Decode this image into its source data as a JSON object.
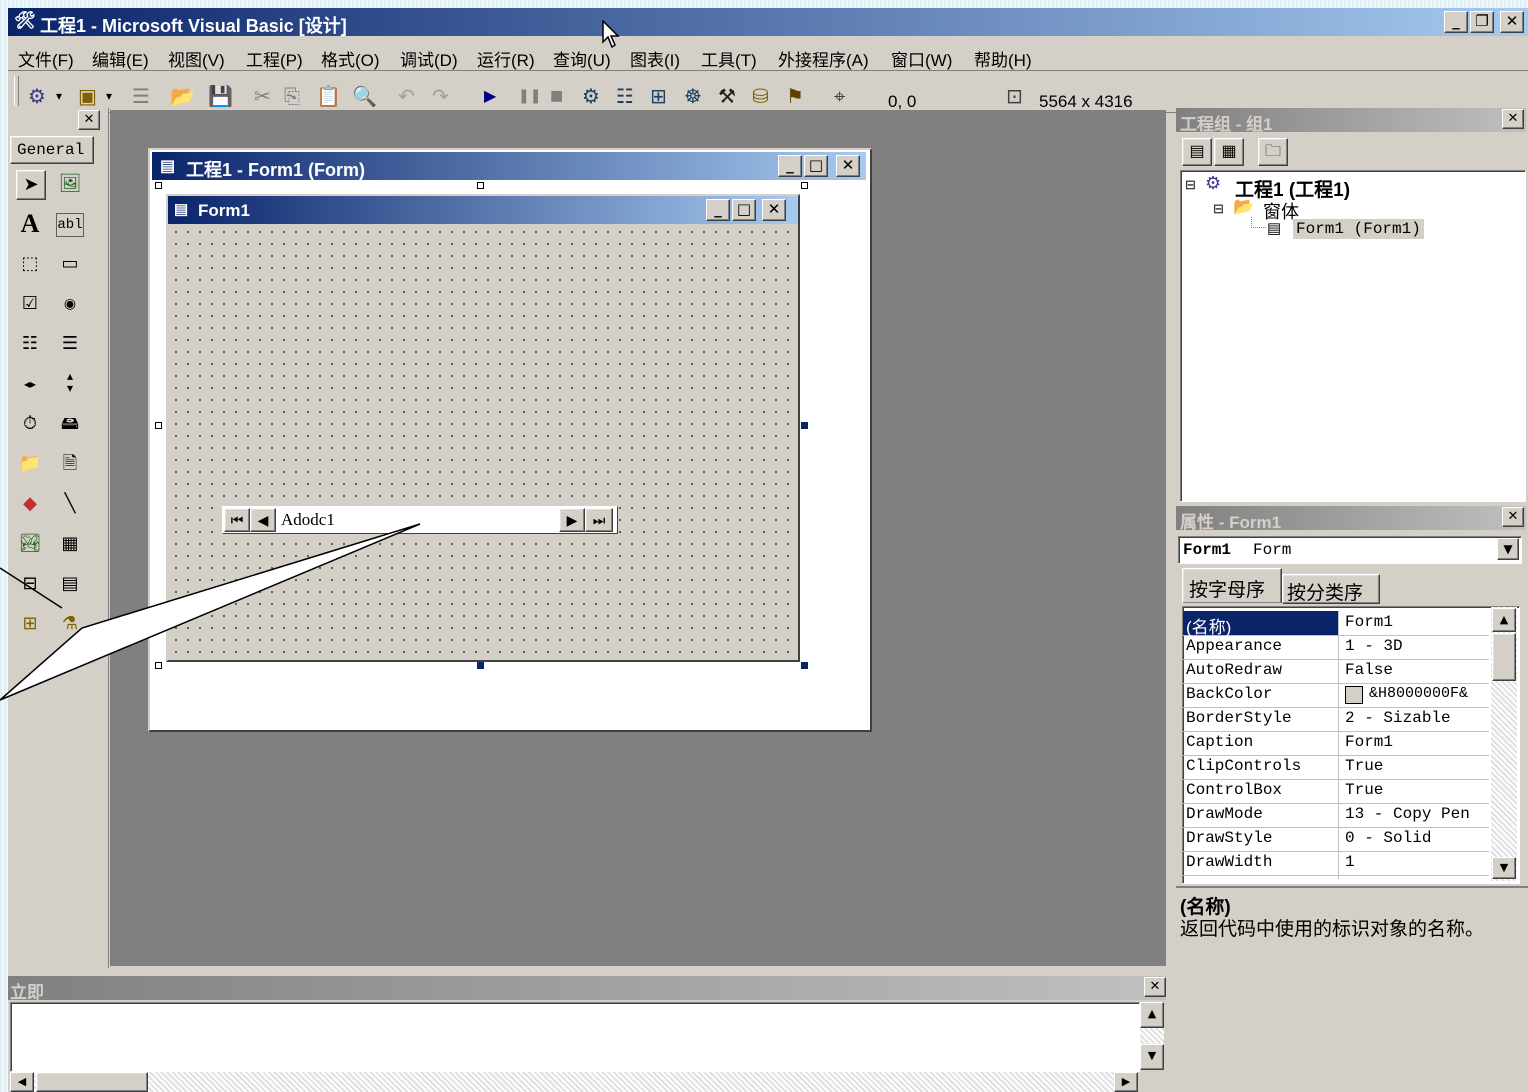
{
  "window": {
    "title": "工程1 - Microsoft Visual Basic [设计]",
    "min": "_",
    "max": "❐",
    "close": "✕"
  },
  "menu": [
    "文件(F)",
    "编辑(E)",
    "视图(V)",
    "工程(P)",
    "格式(O)",
    "调试(D)",
    "运行(R)",
    "查询(U)",
    "图表(I)",
    "工具(T)",
    "外接程序(A)",
    "窗口(W)",
    "帮助(H)"
  ],
  "toolbar": {
    "position": "0, 0",
    "size": "5564 x 4316"
  },
  "toolbox": {
    "tab_label": "General",
    "close": "✕",
    "tools": [
      "pointer",
      "picture-box",
      "label",
      "text-box",
      "frame",
      "command-button",
      "check-box",
      "option-button",
      "combo-box",
      "list-box",
      "hscroll-bar",
      "vscroll-bar",
      "timer",
      "drive-list-box",
      "dir-list-box",
      "file-list-box",
      "shape",
      "line",
      "image",
      "data",
      "ole",
      "adodc-grid",
      "datagrid",
      "adodc"
    ]
  },
  "form_designer": {
    "title": "工程1 - Form1 (Form)",
    "form_caption": "Form1",
    "adodc_caption": "Adodc1"
  },
  "project_explorer": {
    "title": "工程组 - 组1",
    "close": "✕",
    "root": "工程1 (工程1)",
    "folder": "窗体",
    "form": "Form1 (Form1)"
  },
  "properties": {
    "title": "属性 - Form1",
    "close": "✕",
    "object_name": "Form1",
    "object_type": "Form",
    "tab_alpha": "按字母序",
    "tab_category": "按分类序",
    "rows": [
      {
        "name": "(名称)",
        "value": "Form1"
      },
      {
        "name": "Appearance",
        "value": "1 - 3D"
      },
      {
        "name": "AutoRedraw",
        "value": "False"
      },
      {
        "name": "BackColor",
        "value": "&H8000000F&"
      },
      {
        "name": "BorderStyle",
        "value": "2 - Sizable"
      },
      {
        "name": "Caption",
        "value": "Form1"
      },
      {
        "name": "ClipControls",
        "value": "True"
      },
      {
        "name": "ControlBox",
        "value": "True"
      },
      {
        "name": "DrawMode",
        "value": "13 - Copy Pen"
      },
      {
        "name": "DrawStyle",
        "value": "0 - Solid"
      },
      {
        "name": "DrawWidth",
        "value": "1"
      }
    ],
    "desc_title": "(名称)",
    "desc_text": "返回代码中使用的标识对象的名称。"
  },
  "immediate": {
    "title": "立即",
    "close": "✕"
  }
}
